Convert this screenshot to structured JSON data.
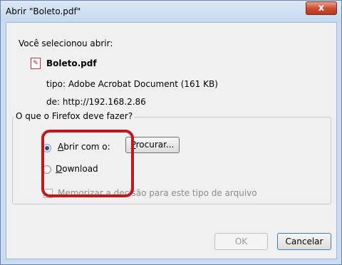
{
  "window": {
    "title": "Abrir \"Boleto.pdf\"",
    "close_glyph": "x"
  },
  "file": {
    "selected_label": "Você selecionou abrir:",
    "name": "Boleto.pdf",
    "icon": "pdf-file-icon",
    "type_label": "tipo:",
    "type_value": "Adobe Acrobat Document (161 KB)",
    "from_label": "de:",
    "from_value": "http://192.168.2.86"
  },
  "action_group": {
    "legend": "O que o Firefox deve fazer?",
    "open_with": {
      "accel": "A",
      "rest": "brir com o:",
      "checked": true
    },
    "browse": {
      "accel": "P",
      "rest": "rocurar..."
    },
    "download": {
      "accel": "D",
      "rest": "ownload",
      "checked": false
    },
    "remember": {
      "accel": "M",
      "rest": "emorizar a decisão para este tipo de arquivo",
      "checked": false,
      "disabled": true
    }
  },
  "buttons": {
    "ok": "OK",
    "cancel": "Cancelar"
  },
  "colors": {
    "highlight": "#c4161c",
    "dialog_bg": "#f0f0f0",
    "frame": "#c9dcf2"
  }
}
